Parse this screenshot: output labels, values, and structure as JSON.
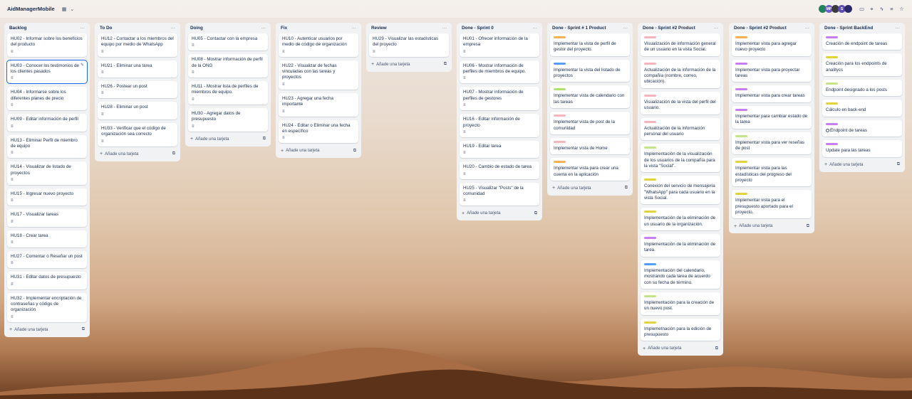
{
  "board": {
    "title": "AidManagerMobile",
    "view_icon": "board-view-icon"
  },
  "topbar": {
    "avatars": [
      {
        "initials": "",
        "color": "#1f845a"
      },
      {
        "initials": "MP",
        "color": "#6e5dc6"
      },
      {
        "initials": "",
        "color": "#3b3b3b"
      },
      {
        "initials": "S",
        "color": "#5e4db2"
      },
      {
        "initials": "",
        "color": "#2a2a6a"
      }
    ]
  },
  "labels": {
    "orange": "#ffb050",
    "pink": "#f5b5bc",
    "blue": "#579dff",
    "green": "#b3df72",
    "yellow": "#e2d33d",
    "purple": "#c97cf4",
    "lime": "#c7e38a"
  },
  "add_card_label": "Añade una tarjeta",
  "lists": [
    {
      "title": "Backlog",
      "cards": [
        {
          "text": "HU02 - Informar sobre los beneficios del producto",
          "desc": true
        },
        {
          "text": "HU03 - Conocer los testimonios de los clientes pasados",
          "desc": true,
          "selected": true
        },
        {
          "text": "HU04 - Informarse sobre los diferentes planes de precio",
          "desc": true
        },
        {
          "text": "HU09 - Editar información de perfil",
          "desc": true
        },
        {
          "text": "HU13 - Eliminar Perfil de miembro de equipo",
          "desc": true
        },
        {
          "text": "HU14 - Visualizar de listado de proyectos",
          "desc": true
        },
        {
          "text": "HU15 - Ingresar nuevo proyecto",
          "desc": true
        },
        {
          "text": "HU17 - Visualizar tareas",
          "desc": true
        },
        {
          "text": "HU18 - Crear tarea",
          "desc": true
        },
        {
          "text": "HU27 - Comentar o Reseñar un post",
          "desc": true
        },
        {
          "text": "HU31 - Editar datos de presupuesto",
          "desc": true
        },
        {
          "text": "HU32 - Implementar encriptación de contraseñas y código de organización",
          "desc": true
        }
      ]
    },
    {
      "title": "To Do",
      "cards": [
        {
          "text": "HU12 - Contactar a los miembros del equipo por medio de WhatsApp",
          "desc": true
        },
        {
          "text": "HU21 - Eliminar una tarea",
          "desc": true
        },
        {
          "text": "HU26 - Postear un post",
          "desc": true
        },
        {
          "text": "HU28 - Eliminar un post",
          "desc": true
        },
        {
          "text": "HU33 - Verificar que el código de organización sea correcto",
          "desc": true
        }
      ]
    },
    {
      "title": "Doing",
      "cards": [
        {
          "text": "HU05 - Contactar con la empresa",
          "desc": true
        },
        {
          "text": "HU08 - Mostrar información de perfil de la ONG",
          "desc": true
        },
        {
          "text": "HU11 - Mostrar lista de perfiles de miembros de equipo.",
          "desc": true
        },
        {
          "text": "HU30 - Agregar datos de presupuesto",
          "desc": true
        }
      ]
    },
    {
      "title": "Fix",
      "cards": [
        {
          "text": "HU10 - Autenticar usuarios por medio de código de organización",
          "desc": true
        },
        {
          "text": "HU22 - Visualizar de fechas vinculadas con las tareas y proyectos",
          "desc": true
        },
        {
          "text": "HU23 - Agregar una fecha importante",
          "desc": true
        },
        {
          "text": "HU24 - Editar o Eliminar una fecha en específico",
          "desc": true
        }
      ]
    },
    {
      "title": "Review",
      "cards": [
        {
          "text": "HU29 - Visualizar las estadísticas del proyecto",
          "desc": true
        }
      ]
    },
    {
      "title": "Done - Sprint 0",
      "cards": [
        {
          "text": "HU01 - Ofrecer información de la empresa",
          "desc": true
        },
        {
          "text": "HU06 - Mostrar información de perfiles de miembros de equipo.",
          "desc": true
        },
        {
          "text": "HU07 - Mostrar información de perfiles de gestores",
          "desc": true
        },
        {
          "text": "HU16 - Editar información de proyecto",
          "desc": true
        },
        {
          "text": "HU19 - Editar tarea",
          "desc": true
        },
        {
          "text": "HU20 - Cambio de estado de tarea",
          "desc": true
        },
        {
          "text": "HU25 - Visualizar \"Posts\" de la comunidad",
          "desc": true
        }
      ]
    },
    {
      "title": "Done - Sprint # 1 Product",
      "cards": [
        {
          "text": "Implementar la vista de perfil de gestor del proyecto.",
          "label": "orange"
        },
        {
          "text": "Implementar la vista del listado de proyectos",
          "label": "blue"
        },
        {
          "text": "Implementar vista de calendario con las tareas",
          "label": "green"
        },
        {
          "text": "Implementar vista de post de la comunidad",
          "label": "pink"
        },
        {
          "text": "Implementar vista de Home",
          "label": "pink"
        },
        {
          "text": "Implementar vista para crear una cuenta en la aplicación",
          "label": "orange"
        }
      ]
    },
    {
      "title": "Done - Sprint #2 Product",
      "cards": [
        {
          "text": "Visualización de información general de un usuario en la vista Social.",
          "label": "pink"
        },
        {
          "text": "Actualización de la información de la compañía (nombre, correo, ubicación).",
          "label": "pink"
        },
        {
          "text": "Visualización de la vista del perfil del usuario.",
          "label": "pink"
        },
        {
          "text": "Actualización de la información personal del usuario",
          "label": "pink"
        },
        {
          "text": "Implementación de la visualización de los usuarios de la compañía para la vista \"Social\".",
          "label": "lime"
        },
        {
          "text": "Conexión del servicio de mensajería \"WhatsApp\" para cada usuario en la vista Social.",
          "label": "yellow"
        },
        {
          "text": "Implementación de la eliminación de un usuario de la organización.",
          "label": "yellow"
        },
        {
          "text": "Implementación de la eliminación de tarea.",
          "label": "purple"
        },
        {
          "text": "Implementación del calendario, mostrando cada tarea de acuerdo con su fecha de término.",
          "label": "blue"
        },
        {
          "text": "Implementación para la creación de un nuevo post.",
          "label": "lime"
        },
        {
          "text": "Implemetnación para la edición de presupuesto",
          "label": "yellow"
        }
      ]
    },
    {
      "title": "Done - Sprint #2 Product",
      "cards": [
        {
          "text": "Implementar vista para agregar nuevo proyecto",
          "label": "orange"
        },
        {
          "text": "Implementar vista para proyectar tareas",
          "label": "purple"
        },
        {
          "text": "Implementar vista para crear tareas",
          "label": "purple"
        },
        {
          "text": "Implementar para cambiar estado de la tarea",
          "label": "purple"
        },
        {
          "text": "Implementar vista para ver reseñas de post",
          "label": "lime"
        },
        {
          "text": "Implementar vista para las estadísticas del progreso del proyecto",
          "label": "yellow"
        },
        {
          "text": "Implementar vista para el presupuesto aportado para el proyecto.",
          "label": "yellow"
        }
      ]
    },
    {
      "title": "Done - Sprint BackEnd",
      "cards": [
        {
          "text": "Creación de endpoint de tareas",
          "label": "purple"
        },
        {
          "text": "Creación para los endpoints de analitycs",
          "label": "yellow"
        },
        {
          "text": "Endpoint designado a los posts",
          "label": "lime"
        },
        {
          "text": "Cálculo en back-end",
          "label": "yellow"
        },
        {
          "text": "Endpoint de tareas",
          "label": "purple",
          "circle": true
        },
        {
          "text": "Update para las tareas",
          "label": "purple"
        }
      ]
    }
  ]
}
